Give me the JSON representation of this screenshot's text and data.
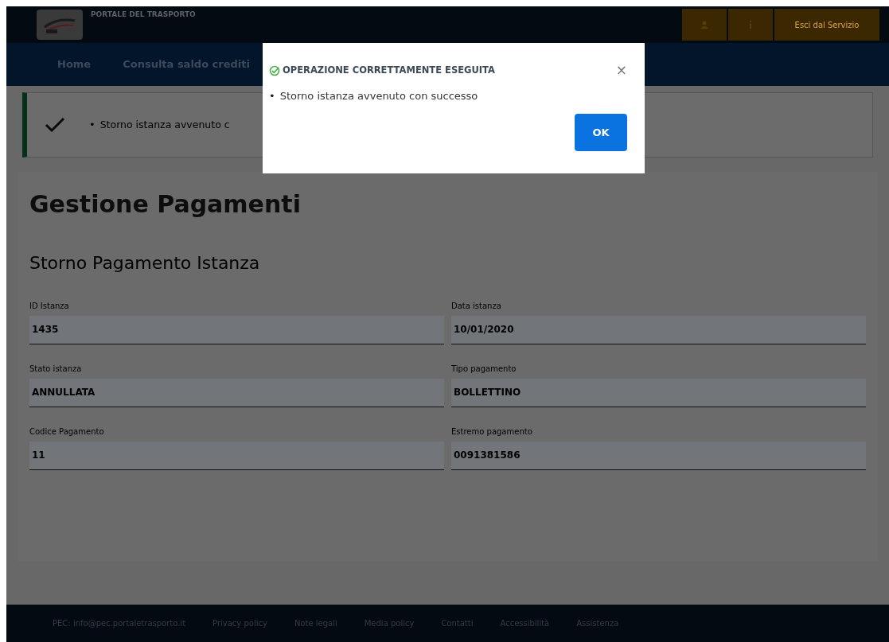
{
  "header": {
    "title": "PORTALE DEL TRASPORTO",
    "exit_button": "Esci dal Servizio"
  },
  "nav": {
    "items": [
      "Home",
      "Consulta saldo crediti"
    ]
  },
  "alert": {
    "messages": [
      {
        "bullet": "•",
        "text": "Storno istanza avvenuto c"
      }
    ]
  },
  "page": {
    "title": "Gestione Pagamenti",
    "subtitle": "Storno Pagamento Istanza",
    "fields": [
      {
        "label": "ID Istanza",
        "value": "1435"
      },
      {
        "label": "Data istanza",
        "value": "10/01/2020"
      },
      {
        "label": "Stato istanza",
        "value": "ANNULLATA"
      },
      {
        "label": "Tipo pagamento",
        "value": "BOLLETTINO"
      },
      {
        "label": "Codice Pagamento",
        "value": "11"
      },
      {
        "label": "Estremo pagamento",
        "value": "0091381586"
      }
    ]
  },
  "footer": {
    "links": [
      "PEC: info@pec.portaletrasporto.it",
      "Privacy policy",
      "Note legali",
      "Media policy",
      "Contatti",
      "Accessibilità",
      "Assistenza"
    ]
  },
  "modal": {
    "title": "OPERAZIONE CORRETTAMENTE ESEGUITA",
    "close": "×",
    "messages": [
      {
        "bullet": "•",
        "text": "Storno istanza avvenuto con successo"
      }
    ],
    "ok_button": "OK"
  }
}
